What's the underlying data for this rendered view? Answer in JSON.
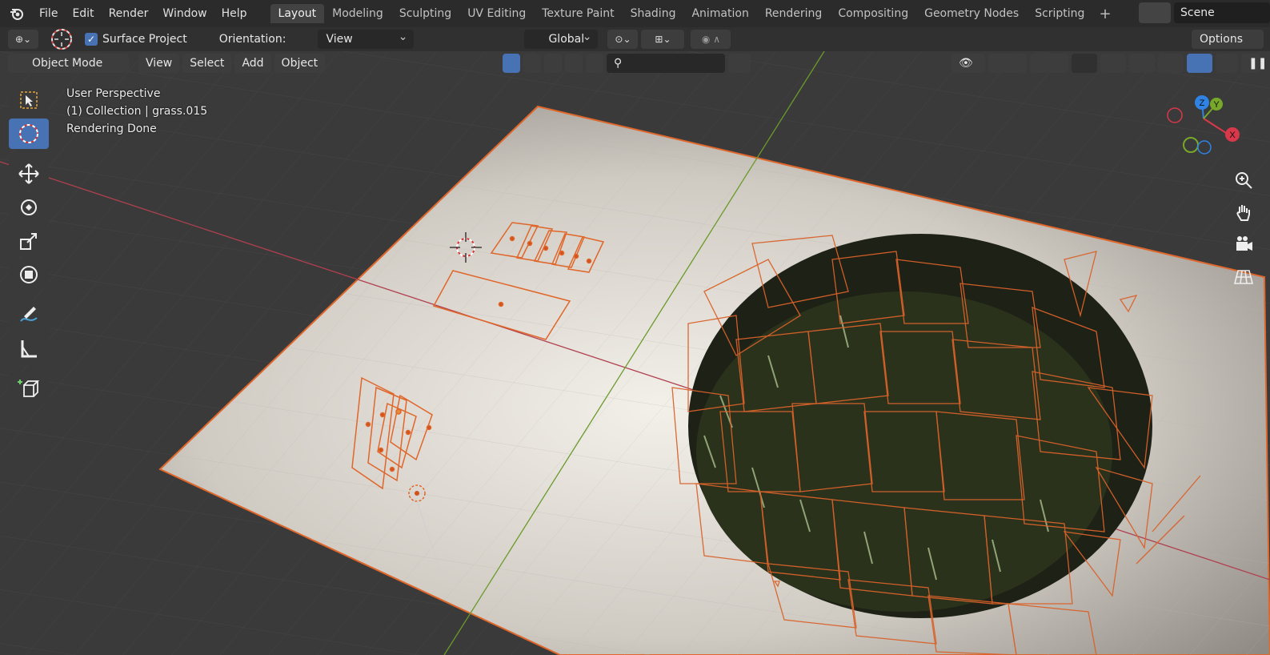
{
  "menu": [
    "File",
    "Edit",
    "Render",
    "Window",
    "Help"
  ],
  "workspaces": [
    {
      "label": "Layout",
      "active": true
    },
    {
      "label": "Modeling"
    },
    {
      "label": "Sculpting"
    },
    {
      "label": "UV Editing"
    },
    {
      "label": "Texture Paint"
    },
    {
      "label": "Shading"
    },
    {
      "label": "Animation"
    },
    {
      "label": "Rendering"
    },
    {
      "label": "Compositing"
    },
    {
      "label": "Geometry Nodes"
    },
    {
      "label": "Scripting"
    }
  ],
  "scene": {
    "name": "Scene"
  },
  "tool_header": {
    "surface_project_label": "Surface Project",
    "surface_project_checked": true,
    "orientation_label": "Orientation:",
    "orientation_value": "View",
    "transform_orientation": "Global",
    "options_label": "Options"
  },
  "viewport_header": {
    "mode": "Object Mode",
    "menus": [
      "View",
      "Select",
      "Add",
      "Object"
    ]
  },
  "overlay_text": {
    "line1": "User Perspective",
    "line2": "(1) Collection | grass.015",
    "line3": "Rendering Done"
  },
  "gizmo": {
    "x": "X",
    "y": "Y",
    "z": "Z"
  },
  "colors": {
    "selection_outline": "#e0662a",
    "active_tool": "#4772b3",
    "x_axis": "#d9384a",
    "y_axis": "#77a829",
    "z_axis": "#2f83e4"
  }
}
